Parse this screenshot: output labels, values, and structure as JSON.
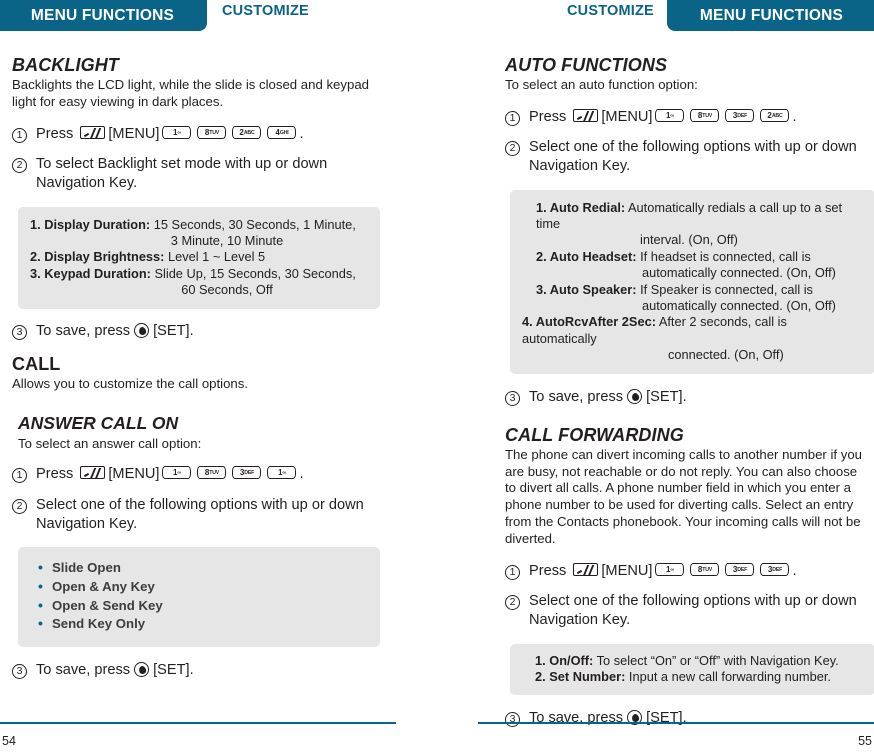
{
  "header": {
    "left_tab": "MENU FUNCTIONS",
    "left_label": "CUSTOMIZE",
    "right_label": "CUSTOMIZE",
    "right_tab": "MENU FUNCTIONS",
    "accent_color": "#0a6488"
  },
  "footer": {
    "left_page": "54",
    "right_page": "55"
  },
  "icons": {
    "menu_key": "menu-key-icon",
    "set_key": "set-key-icon"
  },
  "left": {
    "backlight": {
      "title": "BACKLIGHT",
      "desc": "Backlights the LCD light, while the slide is closed and keypad light for easy viewing in dark places.",
      "step1_prefix": "Press",
      "step1_menu": "[MENU]",
      "step1_keys": [
        {
          "digit": "1",
          "sub": "∞"
        },
        {
          "digit": "8",
          "sub": "TUV"
        },
        {
          "digit": "2",
          "sub": "ABC"
        },
        {
          "digit": "4",
          "sub": "GHI"
        }
      ],
      "step1_suffix": ".",
      "step2": "To select Backlight set mode with up or down Navigation Key.",
      "options": [
        {
          "num": "1.",
          "name": "Display Duration:",
          "value": "15 Seconds, 30 Seconds, 1 Minute,",
          "value2": "3 Minute, 10 Minute"
        },
        {
          "num": "2.",
          "name": "Display Brightness:",
          "value": "Level 1 ~ Level 5",
          "value2": ""
        },
        {
          "num": "3.",
          "name": "Keypad Duration:",
          "value": "Slide Up, 15 Seconds, 30 Seconds,",
          "value2": "60 Seconds, Off"
        }
      ],
      "step3_a": "To save, press",
      "step3_b": "[SET]."
    },
    "call": {
      "title": "CALL",
      "desc": "Allows you to customize the call options."
    },
    "answer_call_on": {
      "title": "ANSWER CALL ON",
      "desc": "To select an answer call option:",
      "step1_prefix": "Press",
      "step1_menu": "[MENU]",
      "step1_keys": [
        {
          "digit": "1",
          "sub": "∞"
        },
        {
          "digit": "8",
          "sub": "TUV"
        },
        {
          "digit": "3",
          "sub": "DEF"
        },
        {
          "digit": "1",
          "sub": "∞"
        }
      ],
      "step1_suffix": ".",
      "step2": "Select one of the following options with up or down Navigation Key.",
      "bullets": [
        "Slide Open",
        "Open & Any Key",
        "Open & Send Key",
        "Send Key Only"
      ],
      "step3_a": "To save, press",
      "step3_b": "[SET]."
    }
  },
  "right": {
    "auto_functions": {
      "title": "AUTO FUNCTIONS",
      "desc": "To select an auto function option:",
      "step1_prefix": "Press",
      "step1_menu": "[MENU]",
      "step1_keys": [
        {
          "digit": "1",
          "sub": "∞"
        },
        {
          "digit": "8",
          "sub": "TUV"
        },
        {
          "digit": "3",
          "sub": "DEF"
        },
        {
          "digit": "2",
          "sub": "ABC"
        }
      ],
      "step1_suffix": ".",
      "step2": "Select one of the following options with up or down Navigation Key.",
      "options": [
        {
          "num": "1.",
          "name": "Auto Redial:",
          "value": "Automatically redials a call up to a set time",
          "value2": "interval. (On, Off)"
        },
        {
          "num": "2.",
          "name": "Auto Headset:",
          "value": "If headset is connected, call is",
          "value2": "automatically connected. (On, Off)"
        },
        {
          "num": "3.",
          "name": "Auto Speaker:",
          "value": "If Speaker is connected, call is",
          "value2": "automatically connected. (On, Off)"
        },
        {
          "num": "4.",
          "name": "AutoRcvAfter 2Sec:",
          "value": "After 2 seconds, call is automatically",
          "value2": "connected. (On, Off)"
        }
      ],
      "step3_a": "To save, press",
      "step3_b": "[SET]."
    },
    "call_forwarding": {
      "title": "CALL FORWARDING",
      "desc": "The phone can divert incoming calls to another number if you are busy, not reachable or do not reply. You can also choose to divert all calls. A phone number field in which you enter a phone number to be used for diverting calls. Select an entry from the Contacts phonebook. Your incoming calls will not be diverted.",
      "step1_prefix": "Press",
      "step1_menu": "[MENU]",
      "step1_keys": [
        {
          "digit": "1",
          "sub": "∞"
        },
        {
          "digit": "8",
          "sub": "TUV"
        },
        {
          "digit": "3",
          "sub": "DEF"
        },
        {
          "digit": "3",
          "sub": "DEF"
        }
      ],
      "step1_suffix": ".",
      "step2": "Select one of the following options with up or down Navigation Key.",
      "options": [
        {
          "num": "1.",
          "name": "On/Off:",
          "value": "To select “On” or “Off” with Navigation Key.",
          "value2": ""
        },
        {
          "num": "2.",
          "name": "Set Number:",
          "value": "Input a new call forwarding number.",
          "value2": ""
        }
      ],
      "step3_a": "To save, press",
      "step3_b": "[SET]."
    }
  }
}
